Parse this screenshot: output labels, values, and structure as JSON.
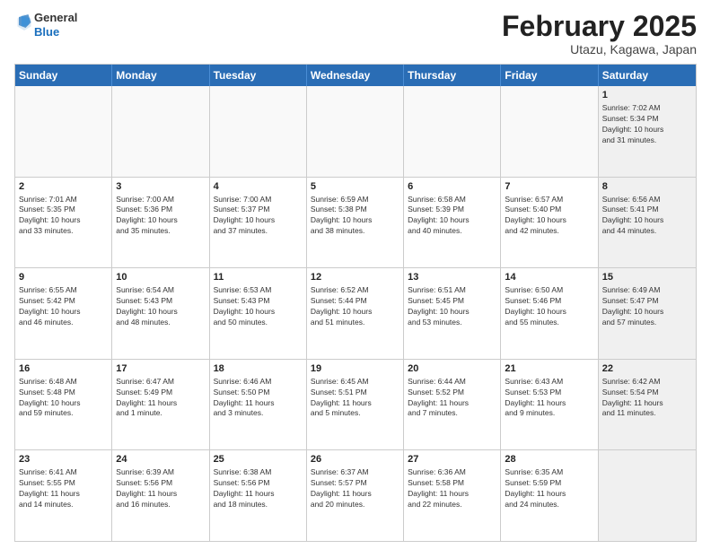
{
  "header": {
    "logo": {
      "line1": "General",
      "line2": "Blue"
    },
    "title": "February 2025",
    "subtitle": "Utazu, Kagawa, Japan"
  },
  "weekdays": [
    "Sunday",
    "Monday",
    "Tuesday",
    "Wednesday",
    "Thursday",
    "Friday",
    "Saturday"
  ],
  "rows": [
    [
      {
        "day": "",
        "text": "",
        "empty": true
      },
      {
        "day": "",
        "text": "",
        "empty": true
      },
      {
        "day": "",
        "text": "",
        "empty": true
      },
      {
        "day": "",
        "text": "",
        "empty": true
      },
      {
        "day": "",
        "text": "",
        "empty": true
      },
      {
        "day": "",
        "text": "",
        "empty": true
      },
      {
        "day": "1",
        "text": "Sunrise: 7:02 AM\nSunset: 5:34 PM\nDaylight: 10 hours\nand 31 minutes.",
        "shaded": true
      }
    ],
    [
      {
        "day": "2",
        "text": "Sunrise: 7:01 AM\nSunset: 5:35 PM\nDaylight: 10 hours\nand 33 minutes."
      },
      {
        "day": "3",
        "text": "Sunrise: 7:00 AM\nSunset: 5:36 PM\nDaylight: 10 hours\nand 35 minutes."
      },
      {
        "day": "4",
        "text": "Sunrise: 7:00 AM\nSunset: 5:37 PM\nDaylight: 10 hours\nand 37 minutes."
      },
      {
        "day": "5",
        "text": "Sunrise: 6:59 AM\nSunset: 5:38 PM\nDaylight: 10 hours\nand 38 minutes."
      },
      {
        "day": "6",
        "text": "Sunrise: 6:58 AM\nSunset: 5:39 PM\nDaylight: 10 hours\nand 40 minutes."
      },
      {
        "day": "7",
        "text": "Sunrise: 6:57 AM\nSunset: 5:40 PM\nDaylight: 10 hours\nand 42 minutes."
      },
      {
        "day": "8",
        "text": "Sunrise: 6:56 AM\nSunset: 5:41 PM\nDaylight: 10 hours\nand 44 minutes.",
        "shaded": true
      }
    ],
    [
      {
        "day": "9",
        "text": "Sunrise: 6:55 AM\nSunset: 5:42 PM\nDaylight: 10 hours\nand 46 minutes."
      },
      {
        "day": "10",
        "text": "Sunrise: 6:54 AM\nSunset: 5:43 PM\nDaylight: 10 hours\nand 48 minutes."
      },
      {
        "day": "11",
        "text": "Sunrise: 6:53 AM\nSunset: 5:43 PM\nDaylight: 10 hours\nand 50 minutes."
      },
      {
        "day": "12",
        "text": "Sunrise: 6:52 AM\nSunset: 5:44 PM\nDaylight: 10 hours\nand 51 minutes."
      },
      {
        "day": "13",
        "text": "Sunrise: 6:51 AM\nSunset: 5:45 PM\nDaylight: 10 hours\nand 53 minutes."
      },
      {
        "day": "14",
        "text": "Sunrise: 6:50 AM\nSunset: 5:46 PM\nDaylight: 10 hours\nand 55 minutes."
      },
      {
        "day": "15",
        "text": "Sunrise: 6:49 AM\nSunset: 5:47 PM\nDaylight: 10 hours\nand 57 minutes.",
        "shaded": true
      }
    ],
    [
      {
        "day": "16",
        "text": "Sunrise: 6:48 AM\nSunset: 5:48 PM\nDaylight: 10 hours\nand 59 minutes."
      },
      {
        "day": "17",
        "text": "Sunrise: 6:47 AM\nSunset: 5:49 PM\nDaylight: 11 hours\nand 1 minute."
      },
      {
        "day": "18",
        "text": "Sunrise: 6:46 AM\nSunset: 5:50 PM\nDaylight: 11 hours\nand 3 minutes."
      },
      {
        "day": "19",
        "text": "Sunrise: 6:45 AM\nSunset: 5:51 PM\nDaylight: 11 hours\nand 5 minutes."
      },
      {
        "day": "20",
        "text": "Sunrise: 6:44 AM\nSunset: 5:52 PM\nDaylight: 11 hours\nand 7 minutes."
      },
      {
        "day": "21",
        "text": "Sunrise: 6:43 AM\nSunset: 5:53 PM\nDaylight: 11 hours\nand 9 minutes."
      },
      {
        "day": "22",
        "text": "Sunrise: 6:42 AM\nSunset: 5:54 PM\nDaylight: 11 hours\nand 11 minutes.",
        "shaded": true
      }
    ],
    [
      {
        "day": "23",
        "text": "Sunrise: 6:41 AM\nSunset: 5:55 PM\nDaylight: 11 hours\nand 14 minutes."
      },
      {
        "day": "24",
        "text": "Sunrise: 6:39 AM\nSunset: 5:56 PM\nDaylight: 11 hours\nand 16 minutes."
      },
      {
        "day": "25",
        "text": "Sunrise: 6:38 AM\nSunset: 5:56 PM\nDaylight: 11 hours\nand 18 minutes."
      },
      {
        "day": "26",
        "text": "Sunrise: 6:37 AM\nSunset: 5:57 PM\nDaylight: 11 hours\nand 20 minutes."
      },
      {
        "day": "27",
        "text": "Sunrise: 6:36 AM\nSunset: 5:58 PM\nDaylight: 11 hours\nand 22 minutes."
      },
      {
        "day": "28",
        "text": "Sunrise: 6:35 AM\nSunset: 5:59 PM\nDaylight: 11 hours\nand 24 minutes."
      },
      {
        "day": "",
        "text": "",
        "empty": true,
        "shaded": true
      }
    ]
  ]
}
